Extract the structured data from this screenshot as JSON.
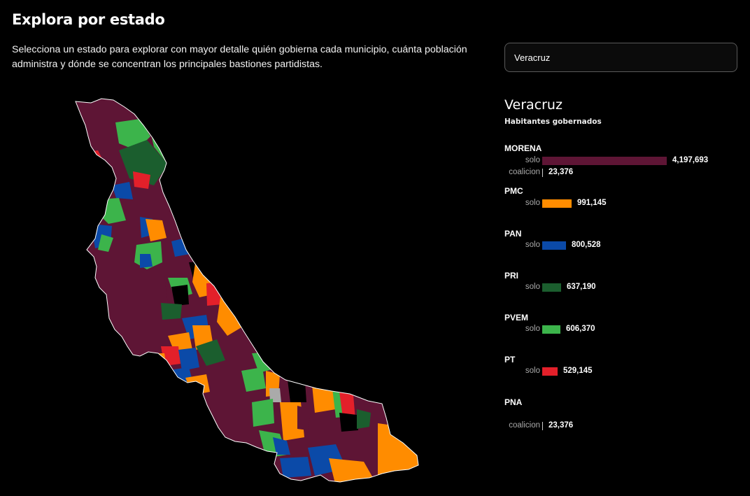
{
  "header": {
    "title": "Explora por estado",
    "intro_line1": "Selecciona un estado para explorar con mayor detalle quién gobierna cada municipio, cuánta población",
    "intro_line2": "administra y dónde se concentran los principales bastiones partidistas."
  },
  "state_select": {
    "value": "Veracruz"
  },
  "panel": {
    "state_name": "Veracruz",
    "subtitle": "Habitantes gobernados",
    "solo_label": "solo",
    "coalition_label": "coalicion"
  },
  "parties": [
    {
      "name": "MORENA",
      "color": "#5e1535",
      "solo": 4197693,
      "solo_text": "4,197,693",
      "coalition_text": "23,376"
    },
    {
      "name": "PMC",
      "color": "#ff8c00",
      "solo": 991145,
      "solo_text": "991,145"
    },
    {
      "name": "PAN",
      "color": "#0b4aa8",
      "solo": 800528,
      "solo_text": "800,528"
    },
    {
      "name": "PRI",
      "color": "#1b5e2e",
      "solo": 637190,
      "solo_text": "637,190"
    },
    {
      "name": "PVEM",
      "color": "#3cb44b",
      "solo": 606370,
      "solo_text": "606,370"
    },
    {
      "name": "PT",
      "color": "#e3202a",
      "solo": 529145,
      "solo_text": "529,145"
    },
    {
      "name": "PNA",
      "color": "#888888",
      "coalition_text": "23,376"
    }
  ],
  "map": {
    "label": "Mapa municipal de Veracruz"
  }
}
